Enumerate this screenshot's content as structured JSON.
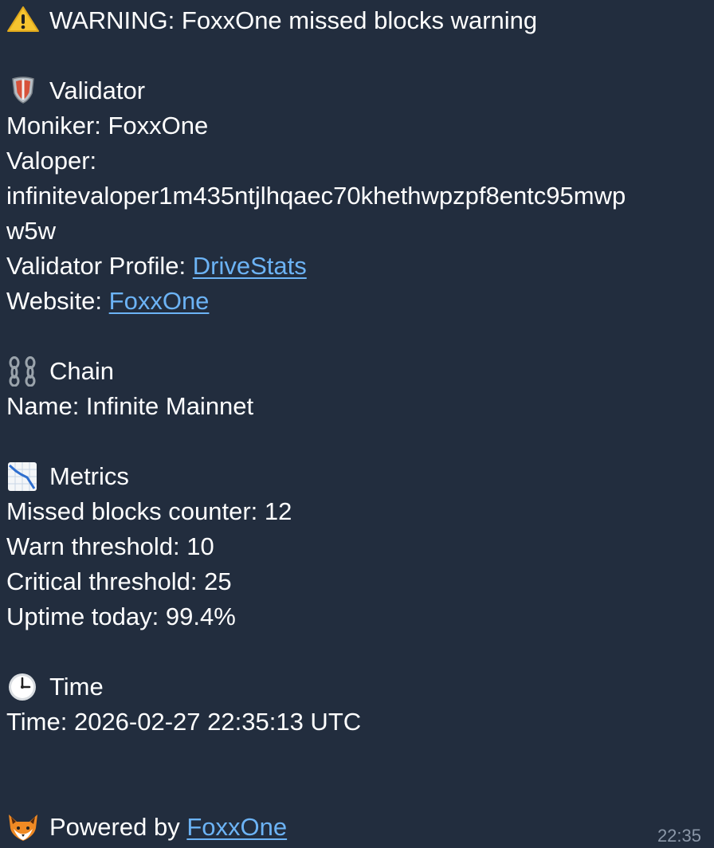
{
  "message": {
    "header": {
      "icon": "warning-icon",
      "text": "WARNING: FoxxOne missed blocks warning"
    },
    "validator": {
      "icon": "shield-icon",
      "heading": "Validator",
      "moniker": "Moniker: FoxxOne",
      "valoper_label": "Valoper:",
      "valoper_line1": "infinitevaloper1m435ntjlhqaec70khethwpzpf8entc95mwp",
      "valoper_line2": "w5w",
      "profile_label": "Validator Profile: ",
      "profile_link": "DriveStats",
      "website_label": "Website: ",
      "website_link": "FoxxOne"
    },
    "chain": {
      "icon": "chain-icon",
      "heading": "Chain",
      "name": "Name: Infinite Mainnet"
    },
    "metrics": {
      "icon": "chart-decreasing-icon",
      "heading": "Metrics",
      "missed": "Missed blocks counter: 12",
      "warn": "Warn threshold: 10",
      "critical": "Critical threshold: 25",
      "uptime": "Uptime today: 99.4%"
    },
    "time": {
      "icon": "clock-icon",
      "heading": "Time",
      "value": "Time: 2026-02-27 22:35:13 UTC"
    },
    "footer": {
      "icon": "fox-icon",
      "label": "Powered by ",
      "link": "FoxxOne"
    },
    "timestamp": "22:35"
  },
  "colors": {
    "background": "#222d3e",
    "text": "#ffffff",
    "link": "#6cb3f5",
    "timestamp": "#8b97a8"
  }
}
